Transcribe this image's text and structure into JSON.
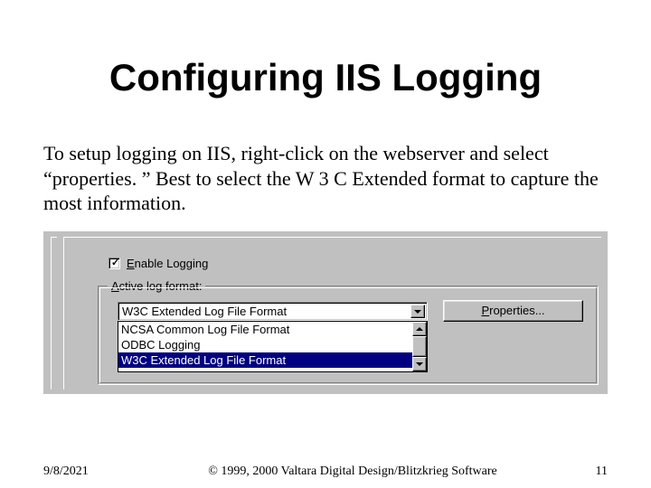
{
  "title": "Configuring IIS Logging",
  "body": "To setup logging on IIS, right-click on the webserver and select “properties. ” Best to select the W 3 C Extended format to capture the most information.",
  "dialog": {
    "enable_logging_label": "Enable Logging",
    "enable_logging_checked": true,
    "group_label": "Active log format:",
    "combo_value": "W3C Extended Log File Format",
    "options": [
      "NCSA Common Log File Format",
      "ODBC Logging",
      "W3C Extended Log File Format"
    ],
    "selected_index": 2,
    "properties_button": "Properties..."
  },
  "footer": {
    "date": "9/8/2021",
    "copyright": "© 1999, 2000 Valtara Digital Design/Blitzkrieg Software",
    "page": "11"
  }
}
